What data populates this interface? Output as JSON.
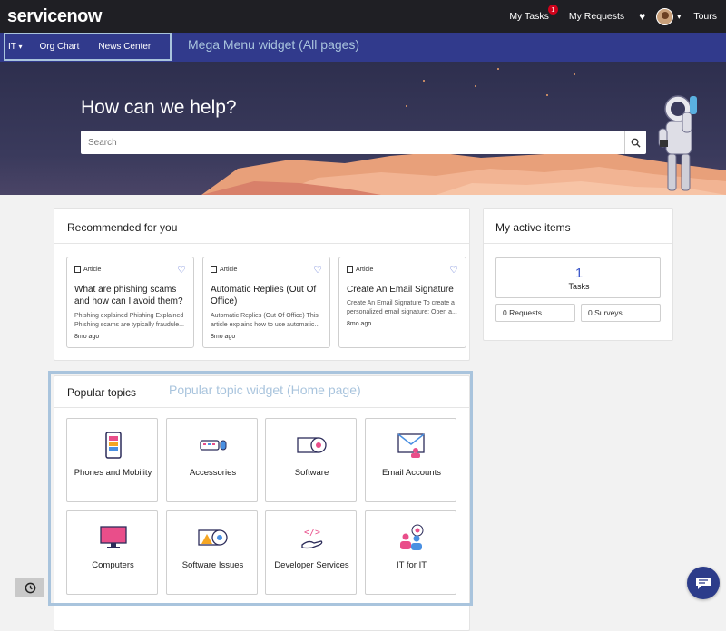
{
  "header": {
    "brand": "servicenow",
    "my_tasks": "My Tasks",
    "tasks_badge": "1",
    "my_requests": "My Requests",
    "tours": "Tours"
  },
  "mega_menu": {
    "items": [
      "IT",
      "Org Chart",
      "News Center"
    ],
    "annotation": "Mega Menu widget (All pages)"
  },
  "hero": {
    "title": "How can we help?",
    "search_placeholder": "Search"
  },
  "recommended": {
    "title": "Recommended for you",
    "articles": [
      {
        "kind": "Article",
        "title": "What are phishing scams and how can I avoid them?",
        "snippet": "Phishing explained Phishing Explained Phishing scams are typically fraudule...",
        "age": "8mo ago"
      },
      {
        "kind": "Article",
        "title": "Automatic Replies (Out Of Office)",
        "snippet": "Automatic Replies (Out Of Office) This article explains how to use automatic...",
        "age": "8mo ago"
      },
      {
        "kind": "Article",
        "title": "Create An Email Signature",
        "snippet": "Create An Email Signature To create a personalized email signature: Open a...",
        "age": "8mo ago"
      }
    ]
  },
  "active_items": {
    "title": "My active items",
    "tasks_count": "1",
    "tasks_label": "Tasks",
    "requests": "0  Requests",
    "surveys": "0  Surveys"
  },
  "popular": {
    "title": "Popular topics",
    "annotation": "Popular topic widget (Home page)",
    "topics": [
      {
        "label": "Phones and Mobility",
        "icon": "phone-icon"
      },
      {
        "label": "Accessories",
        "icon": "keyboard-mouse-icon"
      },
      {
        "label": "Software",
        "icon": "software-disc-icon"
      },
      {
        "label": "Email Accounts",
        "icon": "email-icon"
      },
      {
        "label": "Computers",
        "icon": "monitor-icon"
      },
      {
        "label": "Software Issues",
        "icon": "software-warning-icon"
      },
      {
        "label": "Developer Services",
        "icon": "code-hand-icon"
      },
      {
        "label": "IT for IT",
        "icon": "it-people-icon"
      }
    ]
  },
  "colors": {
    "header_bg": "#1f1f24",
    "megabar_bg": "#313a8c",
    "accent": "#3b56c9",
    "annotation": "#a9c4dd"
  }
}
